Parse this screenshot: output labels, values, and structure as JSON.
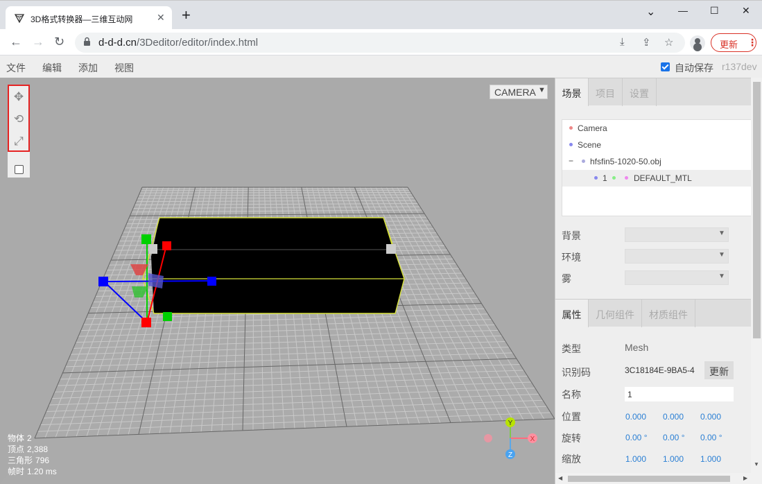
{
  "browser": {
    "tab_title": "3D格式转换器—三维互动网",
    "tab_close": "✕",
    "new_tab": "+",
    "url_host": "d-d-d.cn",
    "url_path": "/3Deditor/editor/index.html",
    "update_label": "更新",
    "update_menu": "⋮",
    "controls": {
      "chevron": "⌄",
      "minimize": "—",
      "maximize": "☐",
      "close": "✕"
    }
  },
  "menubar": {
    "items": [
      "文件",
      "编辑",
      "添加",
      "视图"
    ],
    "autosave_label": "自动保存",
    "autosave_checked": true,
    "version": "r137dev"
  },
  "viewport": {
    "camera_select": "CAMERA",
    "toolbar": [
      "translate-icon",
      "rotate-icon",
      "scale-icon",
      "local-checkbox"
    ],
    "info": [
      {
        "label": "物体",
        "value": "2"
      },
      {
        "label": "顶点",
        "value": "2,388"
      },
      {
        "label": "三角形",
        "value": "796"
      },
      {
        "label": "帧时",
        "value": "1.20 ms"
      }
    ],
    "axes": {
      "x": "X",
      "y": "Y",
      "z": "Z"
    }
  },
  "sidebar": {
    "top_tabs": [
      "场景",
      "项目",
      "设置"
    ],
    "outliner": {
      "camera": "Camera",
      "scene": "Scene",
      "toggle": "−",
      "object": "hfsfin5-1020-50.obj",
      "mesh_name": "1",
      "material": "DEFAULT_MTL"
    },
    "scene_props": [
      "背景",
      "环境",
      "雾"
    ],
    "bottom_tabs": [
      "属性",
      "几何组件",
      "材质组件"
    ],
    "properties": {
      "type_label": "类型",
      "type_value": "Mesh",
      "uuid_label": "识别码",
      "uuid_value": "3C18184E-9BA5-4",
      "uuid_button": "更新",
      "name_label": "名称",
      "name_value": "1",
      "position_label": "位置",
      "position": [
        "0.000",
        "0.000",
        "0.000"
      ],
      "rotation_label": "旋转",
      "rotation": [
        "0.00 °",
        "0.00 °",
        "0.00 °"
      ],
      "scale_label": "缩放",
      "scale": [
        "1.000",
        "1.000",
        "1.000"
      ]
    }
  }
}
